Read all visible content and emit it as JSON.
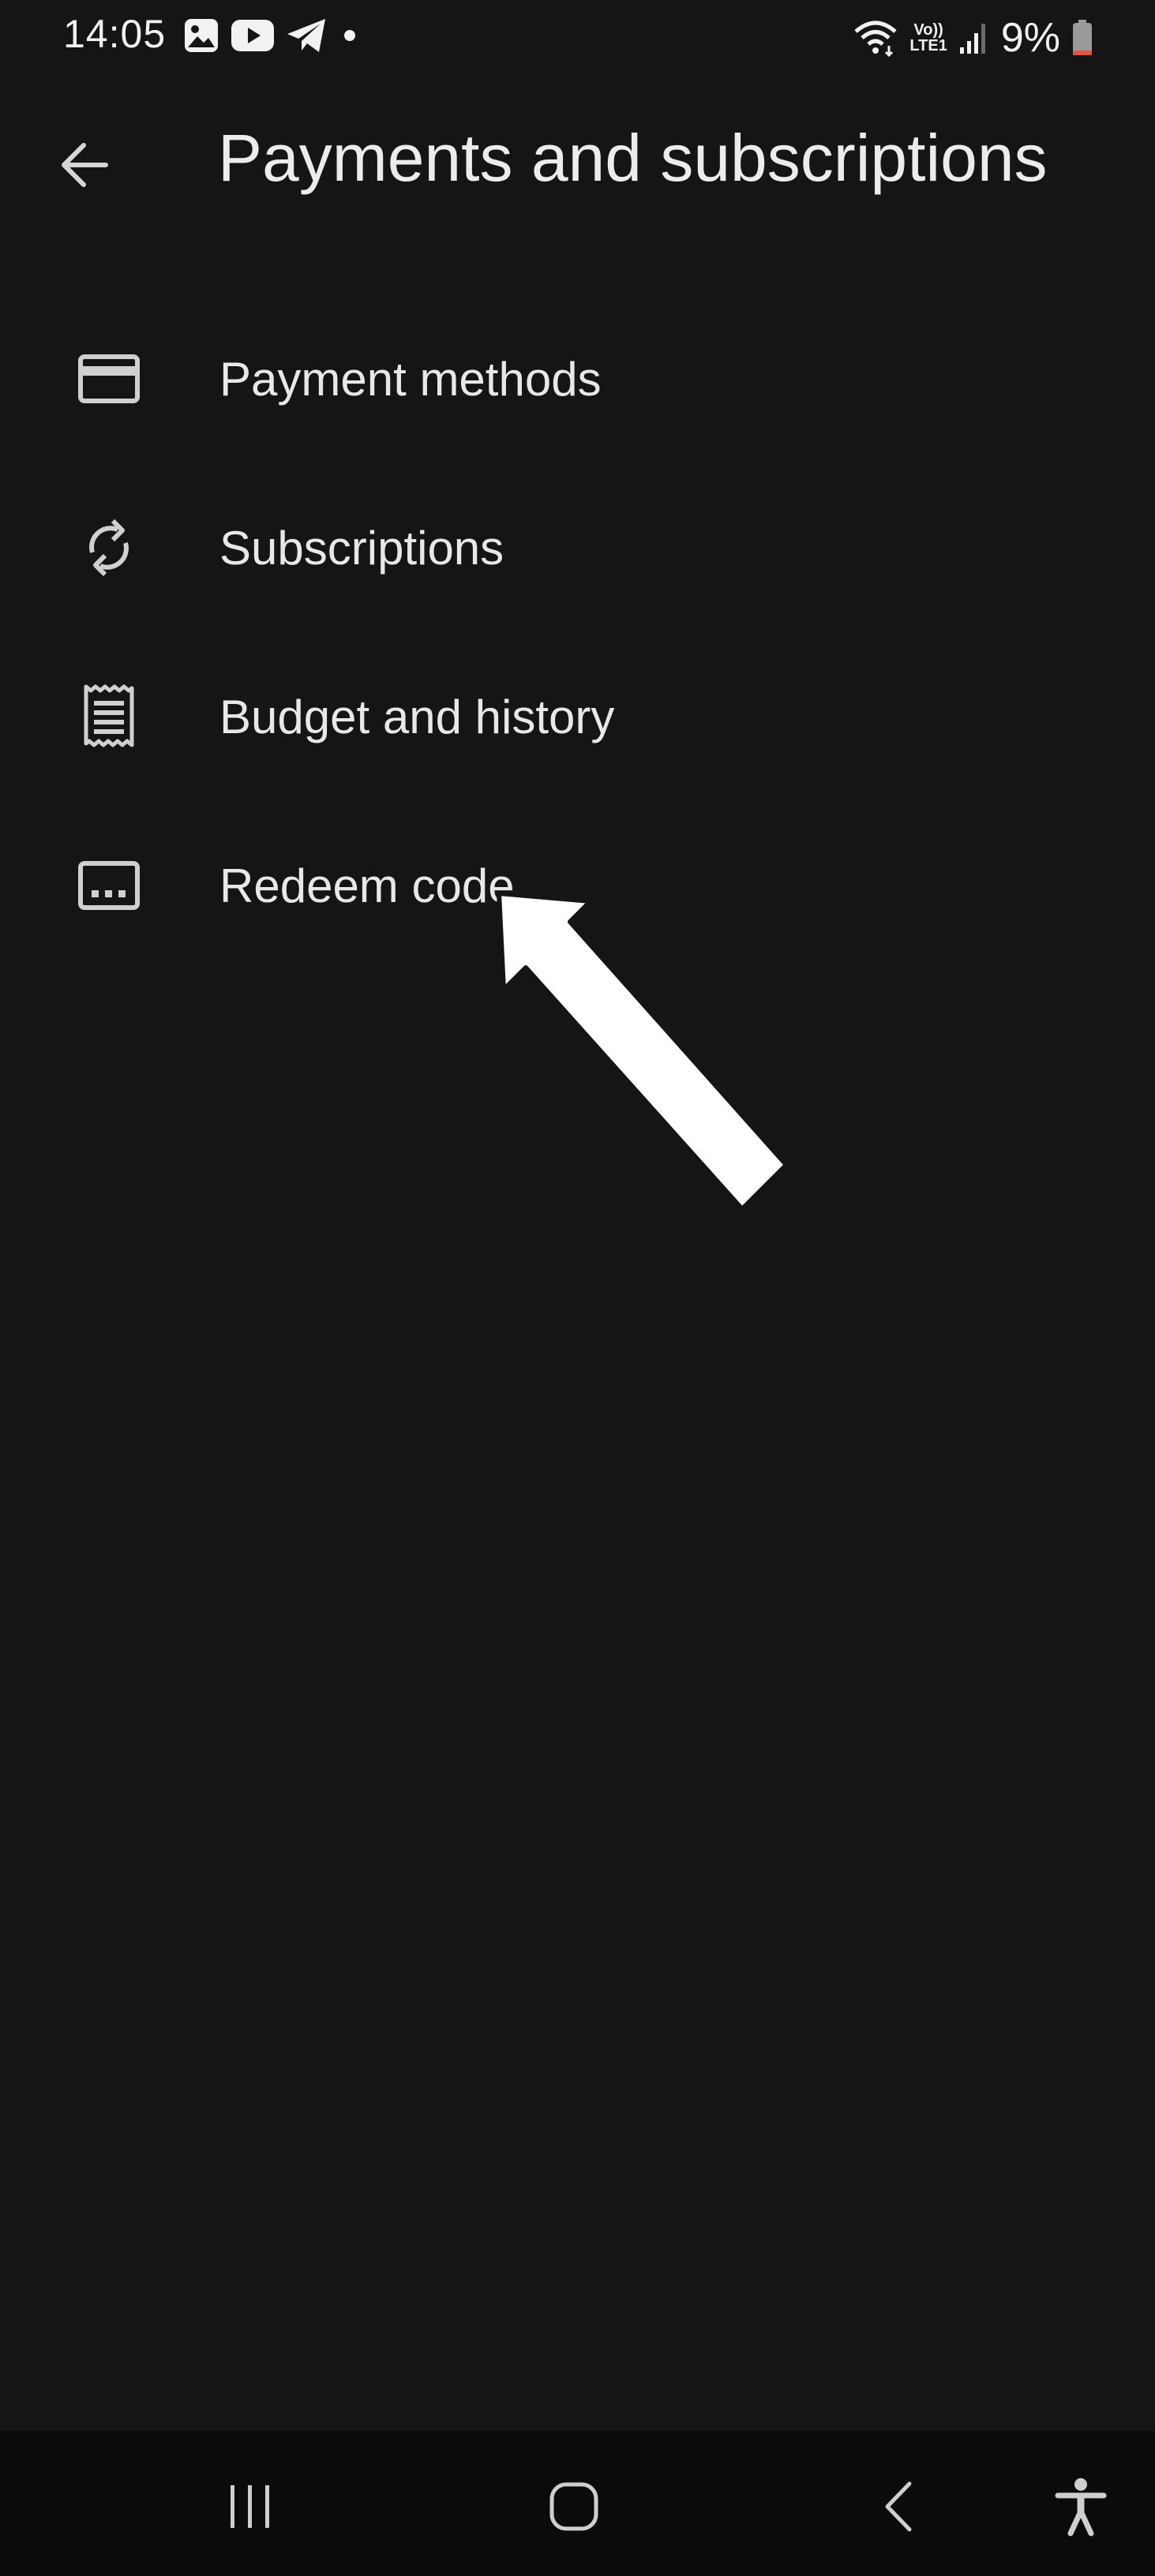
{
  "status_bar": {
    "time": "14:05",
    "left_icons": [
      "gallery-icon",
      "youtube-icon",
      "telegram-icon",
      "dot-icon"
    ],
    "right_icons": [
      "wifi-icon",
      "volte-icon",
      "signal-icon",
      "battery-icon"
    ],
    "volte_label": "Vo))",
    "lte_label": "LTE1",
    "battery_percent": "9%",
    "battery_level": 0.09,
    "battery_color": "#e0573a"
  },
  "header": {
    "back_icon": "arrow-left-icon",
    "title": "Payments and subscriptions"
  },
  "menu": {
    "items": [
      {
        "icon": "credit-card-icon",
        "label": "Payment methods"
      },
      {
        "icon": "sync-icon",
        "label": "Subscriptions"
      },
      {
        "icon": "receipt-icon",
        "label": "Budget and history"
      },
      {
        "icon": "redeem-code-icon",
        "label": "Redeem code"
      }
    ]
  },
  "annotation": {
    "icon": "pointer-arrow",
    "color": "#ffffff"
  },
  "nav_bar": {
    "items": [
      "recents-icon",
      "home-icon",
      "back-chevron-icon",
      "accessibility-icon"
    ]
  },
  "colors": {
    "background": "#151515",
    "nav_background": "#0b0b0b",
    "text": "#e8e8e8"
  }
}
